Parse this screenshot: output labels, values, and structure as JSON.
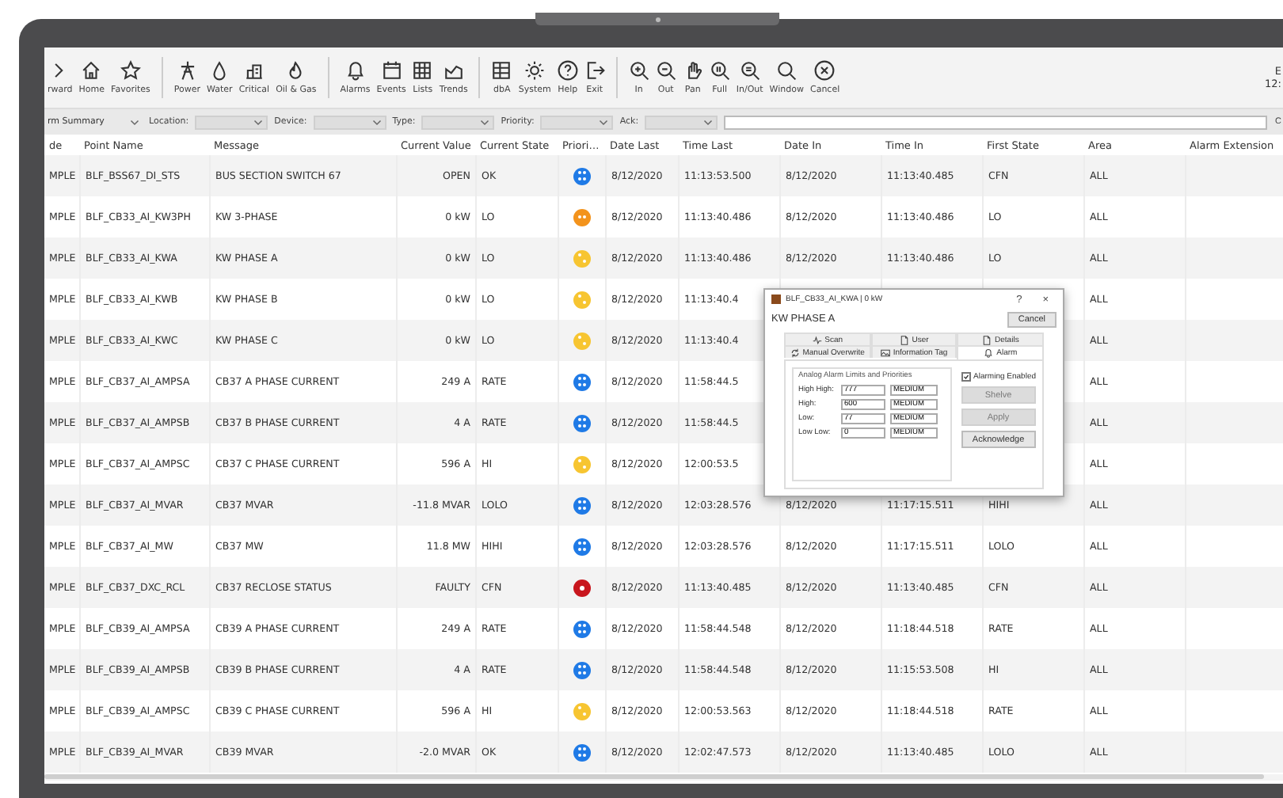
{
  "toolbar": {
    "groups": [
      [
        {
          "label": "rward"
        },
        {
          "label": "Home"
        },
        {
          "label": "Favorites"
        }
      ],
      [
        {
          "label": "Power"
        },
        {
          "label": "Water"
        },
        {
          "label": "Critical"
        },
        {
          "label": "Oil & Gas"
        }
      ],
      [
        {
          "label": "Alarms"
        },
        {
          "label": "Events"
        },
        {
          "label": "Lists"
        },
        {
          "label": "Trends"
        }
      ],
      [
        {
          "label": "dbA"
        },
        {
          "label": "System"
        },
        {
          "label": "Help"
        },
        {
          "label": "Exit"
        }
      ],
      [
        {
          "label": "In"
        },
        {
          "label": "Out"
        },
        {
          "label": "Pan"
        },
        {
          "label": "Full"
        },
        {
          "label": "In/Out"
        },
        {
          "label": "Window"
        },
        {
          "label": "Cancel"
        }
      ]
    ],
    "clock": [
      "E",
      "12:"
    ]
  },
  "filters": {
    "view": "rm Summary",
    "fields": [
      {
        "label": "Location:"
      },
      {
        "label": "Device:"
      },
      {
        "label": "Type:"
      },
      {
        "label": "Priority:"
      },
      {
        "label": "Ack:"
      }
    ],
    "button": "C"
  },
  "table": {
    "columns": [
      "de",
      "Point Name",
      "Message",
      "Current Value",
      "Current State",
      "Priori…",
      "Date Last",
      "Time Last",
      "Date In",
      "Time In",
      "First State",
      "Area",
      "Alarm Extension"
    ],
    "rows": [
      {
        "column_1": "MPLE",
        "point_name": "BLF_BSS67_DI_STS",
        "message": "BUS SECTION SWITCH 67",
        "current_value": "OPEN",
        "current_state": "OK",
        "priority": {
          "kind": "quad",
          "color": "#1f7ae6"
        },
        "date_last": "8/12/2020",
        "time_last": "11:13:53.500",
        "date_in": "8/12/2020",
        "time_in": "11:13:40.485",
        "first_state": "CFN",
        "area": "ALL"
      },
      {
        "column_1": "MPLE",
        "point_name": "BLF_CB33_AI_KW3PH",
        "message": "KW 3-PHASE",
        "current_value": "0 kW",
        "current_state": "LO",
        "priority": {
          "kind": "pair",
          "color": "#f3931c"
        },
        "date_last": "8/12/2020",
        "time_last": "11:13:40.486",
        "date_in": "8/12/2020",
        "time_in": "11:13:40.486",
        "first_state": "LO",
        "area": "ALL"
      },
      {
        "column_1": "MPLE",
        "point_name": "BLF_CB33_AI_KWA",
        "message": "KW PHASE A",
        "current_value": "0 kW",
        "current_state": "LO",
        "priority": {
          "kind": "diagonal",
          "color": "#f7c531"
        },
        "date_last": "8/12/2020",
        "time_last": "11:13:40.486",
        "date_in": "8/12/2020",
        "time_in": "11:13:40.486",
        "first_state": "LO",
        "area": "ALL"
      },
      {
        "column_1": "MPLE",
        "point_name": "BLF_CB33_AI_KWB",
        "message": "KW PHASE B",
        "current_value": "0 kW",
        "current_state": "LO",
        "priority": {
          "kind": "diagonal",
          "color": "#f7c531"
        },
        "date_last": "8/12/2020",
        "time_last": "11:13:40.4",
        "area": "ALL"
      },
      {
        "column_1": "MPLE",
        "point_name": "BLF_CB33_AI_KWC",
        "message": "KW PHASE C",
        "current_value": "0 kW",
        "current_state": "LO",
        "priority": {
          "kind": "diagonal",
          "color": "#f7c531"
        },
        "date_last": "8/12/2020",
        "time_last": "11:13:40.4",
        "area": "ALL"
      },
      {
        "column_1": "MPLE",
        "point_name": "BLF_CB37_AI_AMPSA",
        "message": "CB37 A PHASE CURRENT",
        "current_value": "249 A",
        "current_state": "RATE",
        "priority": {
          "kind": "quad",
          "color": "#1f7ae6"
        },
        "date_last": "8/12/2020",
        "time_last": "11:58:44.5",
        "area": "ALL"
      },
      {
        "column_1": "MPLE",
        "point_name": "BLF_CB37_AI_AMPSB",
        "message": "CB37 B PHASE CURRENT",
        "current_value": "4 A",
        "current_state": "RATE",
        "priority": {
          "kind": "quad",
          "color": "#1f7ae6"
        },
        "date_last": "8/12/2020",
        "time_last": "11:58:44.5",
        "area": "ALL"
      },
      {
        "column_1": "MPLE",
        "point_name": "BLF_CB37_AI_AMPSC",
        "message": "CB37 C PHASE CURRENT",
        "current_value": "596 A",
        "current_state": "HI",
        "priority": {
          "kind": "diagonal",
          "color": "#f7c531"
        },
        "date_last": "8/12/2020",
        "time_last": "12:00:53.5",
        "area": "ALL"
      },
      {
        "column_1": "MPLE",
        "point_name": "BLF_CB37_AI_MVAR",
        "message": "CB37 MVAR",
        "current_value": "-11.8 MVAR",
        "current_state": "LOLO",
        "priority": {
          "kind": "quad",
          "color": "#1f7ae6"
        },
        "date_last": "8/12/2020",
        "time_last": "12:03:28.576",
        "date_in": "8/12/2020",
        "time_in": "11:17:15.511",
        "first_state": "HIHI",
        "area": "ALL"
      },
      {
        "column_1": "MPLE",
        "point_name": "BLF_CB37_AI_MW",
        "message": "CB37 MW",
        "current_value": "11.8 MW",
        "current_state": "HIHI",
        "priority": {
          "kind": "quad",
          "color": "#1f7ae6"
        },
        "date_last": "8/12/2020",
        "time_last": "12:03:28.576",
        "date_in": "8/12/2020",
        "time_in": "11:17:15.511",
        "first_state": "LOLO",
        "area": "ALL"
      },
      {
        "column_1": "MPLE",
        "point_name": "BLF_CB37_DXC_RCL",
        "message": "CB37 RECLOSE STATUS",
        "current_value": "FAULTY",
        "current_state": "CFN",
        "priority": {
          "kind": "single",
          "color": "#c8161d"
        },
        "date_last": "8/12/2020",
        "time_last": "11:13:40.485",
        "date_in": "8/12/2020",
        "time_in": "11:13:40.485",
        "first_state": "CFN",
        "area": "ALL"
      },
      {
        "column_1": "MPLE",
        "point_name": "BLF_CB39_AI_AMPSA",
        "message": "CB39 A PHASE CURRENT",
        "current_value": "249 A",
        "current_state": "RATE",
        "priority": {
          "kind": "quad",
          "color": "#1f7ae6"
        },
        "date_last": "8/12/2020",
        "time_last": "11:58:44.548",
        "date_in": "8/12/2020",
        "time_in": "11:18:44.518",
        "first_state": "RATE",
        "area": "ALL"
      },
      {
        "column_1": "MPLE",
        "point_name": "BLF_CB39_AI_AMPSB",
        "message": "CB39 B PHASE CURRENT",
        "current_value": "4 A",
        "current_state": "RATE",
        "priority": {
          "kind": "quad",
          "color": "#1f7ae6"
        },
        "date_last": "8/12/2020",
        "time_last": "11:58:44.548",
        "date_in": "8/12/2020",
        "time_in": "11:15:53.508",
        "first_state": "HI",
        "area": "ALL"
      },
      {
        "column_1": "MPLE",
        "point_name": "BLF_CB39_AI_AMPSC",
        "message": "CB39 C PHASE CURRENT",
        "current_value": "596 A",
        "current_state": "HI",
        "priority": {
          "kind": "diagonal",
          "color": "#f7c531"
        },
        "date_last": "8/12/2020",
        "time_last": "12:00:53.563",
        "date_in": "8/12/2020",
        "time_in": "11:18:44.518",
        "first_state": "RATE",
        "area": "ALL"
      },
      {
        "column_1": "MPLE",
        "point_name": "BLF_CB39_AI_MVAR",
        "message": "CB39 MVAR",
        "current_value": "-2.0 MVAR",
        "current_state": "OK",
        "priority": {
          "kind": "quad",
          "color": "#1f7ae6"
        },
        "date_last": "8/12/2020",
        "time_last": "12:02:47.573",
        "date_in": "8/12/2020",
        "time_in": "11:13:40.485",
        "first_state": "LOLO",
        "area": "ALL"
      }
    ]
  },
  "dialog": {
    "title": "BLF_CB33_AI_KWA | 0 kW",
    "help": "?",
    "close": "×",
    "heading": "KW PHASE A",
    "cancel": "Cancel",
    "tab_rows": [
      [
        {
          "label": "Scan",
          "selected": false
        },
        {
          "label": "User",
          "selected": false
        },
        {
          "label": "Details",
          "selected": false
        }
      ],
      [
        {
          "label": "Manual Overwrite",
          "selected": false
        },
        {
          "label": "Information Tag",
          "selected": false
        },
        {
          "label": "Alarm",
          "selected": true
        }
      ]
    ],
    "group_title": "Analog Alarm Limits and Priorities",
    "limits": [
      {
        "label": "High High:",
        "value": "777",
        "priority": "MEDIUM"
      },
      {
        "label": "High:",
        "value": "600",
        "priority": "MEDIUM"
      },
      {
        "label": "Low:",
        "value": "77",
        "priority": "MEDIUM"
      },
      {
        "label": "Low Low:",
        "value": "0",
        "priority": "MEDIUM"
      }
    ],
    "alarming_enabled": {
      "label": "Alarming Enabled",
      "checked": true
    },
    "buttons": [
      {
        "label": "Shelve",
        "disabled": true
      },
      {
        "label": "Apply",
        "disabled": true
      },
      {
        "label": "Acknowledge",
        "disabled": false
      }
    ]
  }
}
